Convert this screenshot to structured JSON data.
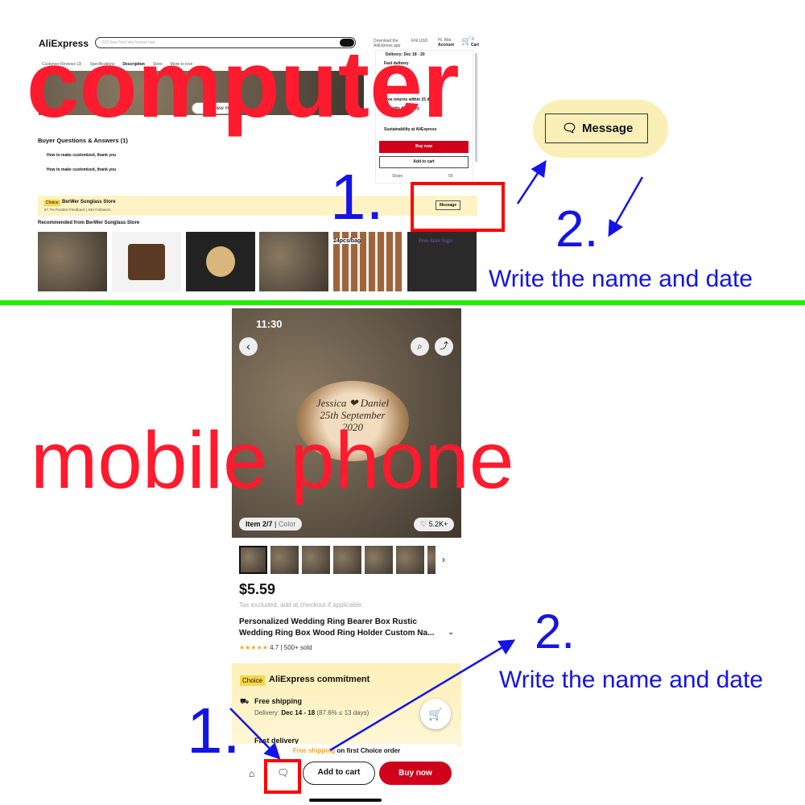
{
  "desktop": {
    "logo": "AliExpress",
    "search_placeholder": "613 lace front wig human hair",
    "download_app": "Download the AliExpress app",
    "lang": "EN/ USD",
    "account_greeting": "Hi, Rita",
    "account_label": "Account",
    "cart_count": "0",
    "cart_label": "Cart",
    "tabs": [
      "Customer Reviews (2)",
      "Specifications",
      "Description",
      "Store",
      "More to love"
    ],
    "view_more": "View more",
    "delivery": "Delivery: Dec 18 - 20",
    "services": [
      "Fast delivery",
      "Free returns within 15 days",
      "Security & Privacy",
      "Sustainability at AliExpress"
    ],
    "buy_now": "Buy now",
    "add_to_cart": "Add to cart",
    "share": "Share",
    "wishlist_count": "59",
    "qa_title": "Buyer Questions & Answers (1)",
    "questions": [
      "How to make customized, thank you",
      "How to make customized, thank you"
    ],
    "store_badge": "Choice",
    "store_name": "BerWer Sunglass Store",
    "store_stats": "97.7% Positive Feedback | 925 Followers",
    "message": "Message",
    "recommended": "Recommended from BerWer Sunglass Store",
    "rec_labels": [
      "24pcs/bag",
      "Free laser logo"
    ],
    "zoom_message": "Message"
  },
  "mobile": {
    "time": "11:30",
    "engraving": [
      "Jessica",
      "Daniel",
      "25th September",
      "2020"
    ],
    "item_index": "Item 2/7",
    "item_variant": "Color",
    "likes": "5.2K+",
    "price": "$5.59",
    "tax_note": "Tax excluded, add at checkout if applicable.",
    "title": "Personalized Wedding Ring Bearer Box Rustic Wedding Ring Box Wood Ring Holder Custom Na...",
    "rating": "4.7",
    "sold": "500+ sold",
    "choice_badge": "Choice",
    "commitment": "AliExpress commitment",
    "free_shipping": "Free shipping",
    "delivery_prefix": "Delivery:",
    "delivery_dates": "Dec 14 - 18",
    "delivery_stats": "(87.6% ≤ 13 days)",
    "fast_delivery": "Fast delivery",
    "banner_highlight": "Free shipping",
    "banner_rest": "on first Choice order",
    "add_to_cart": "Add to cart",
    "buy_now": "Buy now"
  },
  "annotations": {
    "computer": "computer",
    "mobile": "mobile phone",
    "step1": "1.",
    "step2": "2.",
    "instruction": "Write the name and date"
  },
  "colors": {
    "annotation_red": "#ff1a2e",
    "annotation_blue": "#1414e6",
    "divider_green": "#22ee00",
    "buy_red": "#d0021b",
    "choice_yellow": "#fdf3c4"
  }
}
